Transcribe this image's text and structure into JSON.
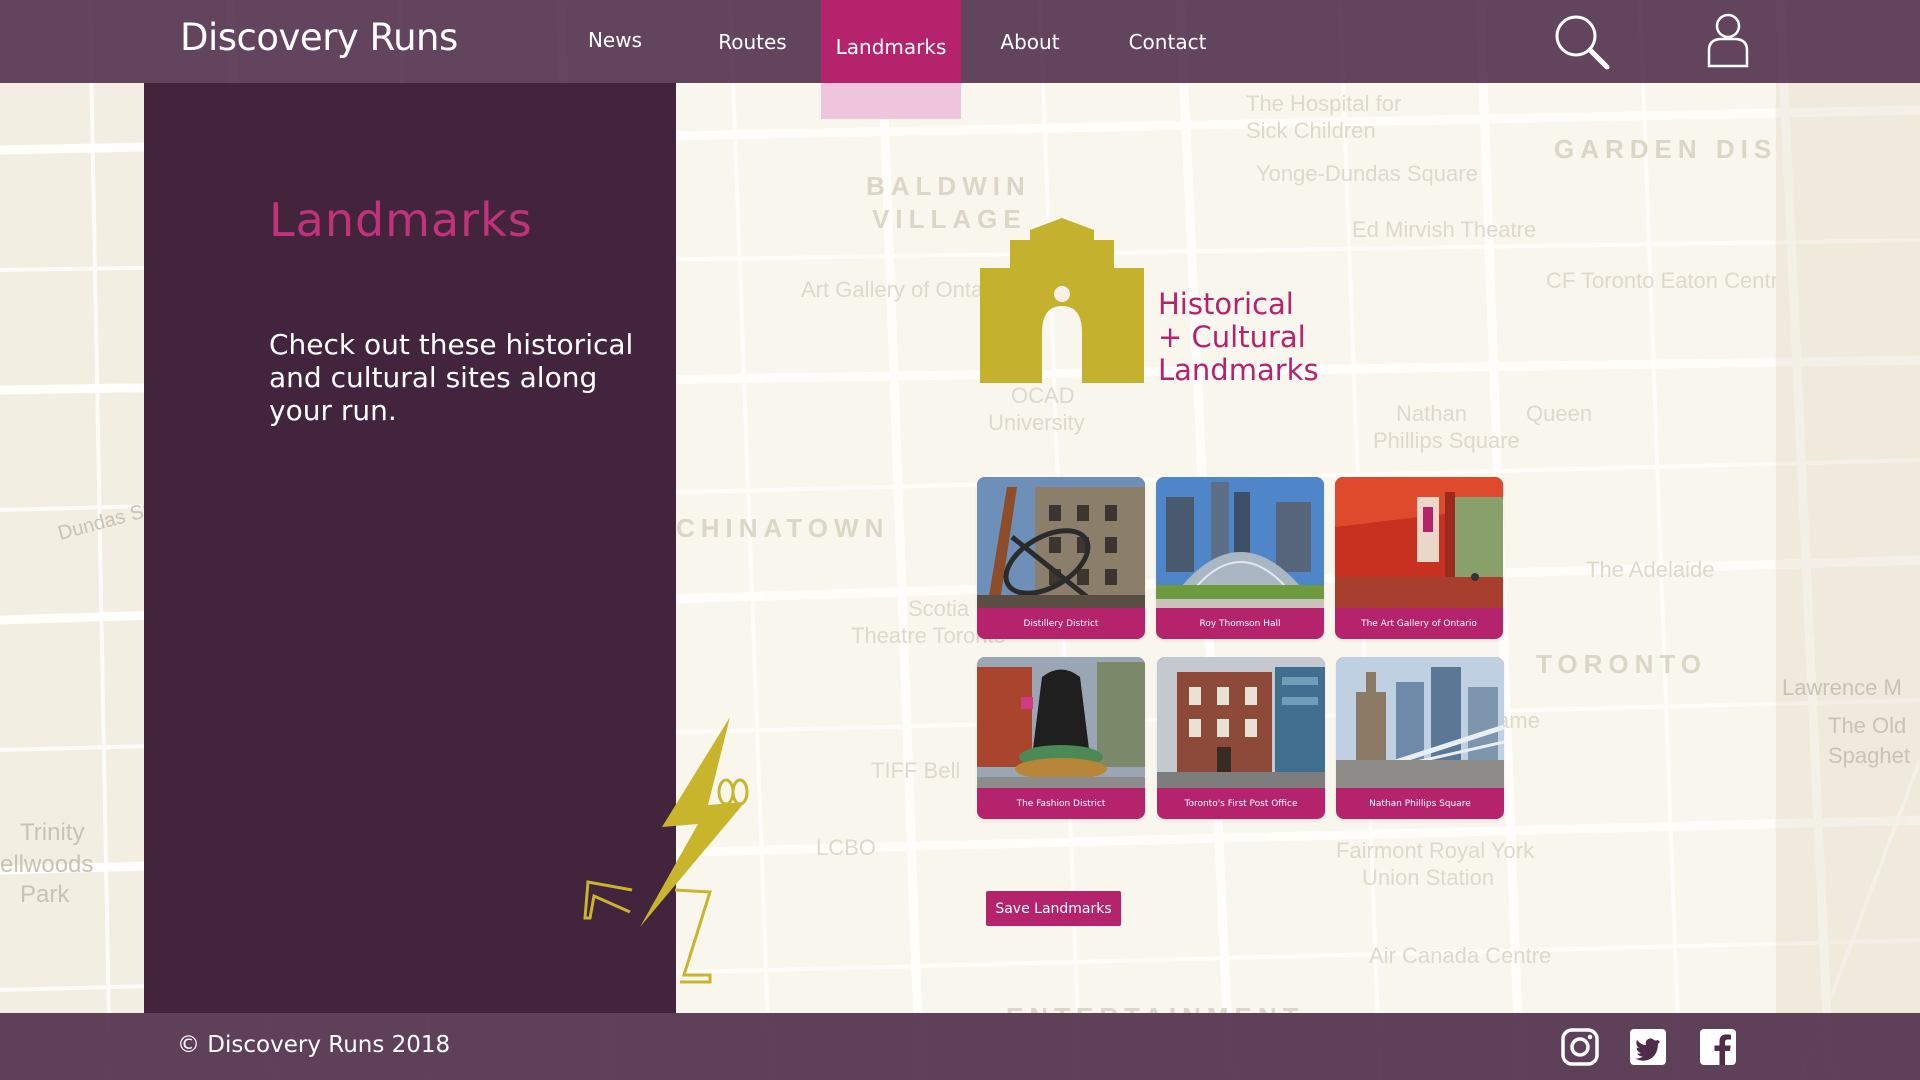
{
  "header": {
    "brand": "Discovery Runs",
    "nav": [
      {
        "label": "News"
      },
      {
        "label": "Routes"
      },
      {
        "label": "Landmarks",
        "active": true
      },
      {
        "label": "About"
      },
      {
        "label": "Contact"
      }
    ],
    "icons": {
      "search": "search-icon",
      "user": "user-icon"
    }
  },
  "sidebar": {
    "title": "Landmarks",
    "description": "Check out these historical and cultural sites along your run."
  },
  "logo": {
    "line1": "Historical",
    "line2": "+ Cultural",
    "line3": "Landmarks"
  },
  "landmarks": [
    {
      "name": "Distillery District"
    },
    {
      "name": "Roy Thomson Hall"
    },
    {
      "name": "The Art Gallery of Ontario"
    },
    {
      "name": "The Fashion District"
    },
    {
      "name": "Toronto's First Post Office"
    },
    {
      "name": "Nathan Phillips Square"
    }
  ],
  "actions": {
    "save_label": "Save Landmarks"
  },
  "footer": {
    "copyright": "© Discovery Runs 2018",
    "social": [
      "instagram-icon",
      "twitter-icon",
      "facebook-icon"
    ]
  },
  "map_labels": {
    "garden_district": "GARDEN DISTRICT",
    "baldwin": "BALDWIN",
    "village": "VILLAGE",
    "chinatown": "CHINATOWN",
    "downtown": "TORONTO",
    "entertainment": "ENTERTAINMENT",
    "district": "DISTRICT",
    "hospital": "The Hospital for",
    "hospital2": "Sick Children",
    "yonge": "Yonge-Dundas Square",
    "mirvish": "Ed Mirvish Theatre",
    "eaton": "CF Toronto Eaton Centre",
    "ago": "Art Gallery of Ontario",
    "ocad": "OCAD",
    "ocad2": "University",
    "nathan": "Nathan",
    "nathan2": "Phillips Square",
    "queen": "Queen",
    "adelaide": "The Adelaide",
    "scotia": "Scotia",
    "scotia2": "Theatre Toronto",
    "tiff": "TIFF Bell",
    "lcbo": "LCBO",
    "fame": "all of Fame",
    "fairmont": "Fairmont Royal York",
    "union": "Union Station",
    "aircanada": "Air Canada Centre",
    "trinity": "Trinity",
    "bellwoods": "ellwoods",
    "park": "Park",
    "dundas": "Dundas St",
    "lawrence": "Lawrence M",
    "spaghetti": "The Old",
    "spaghetti2": "Spaghet"
  }
}
